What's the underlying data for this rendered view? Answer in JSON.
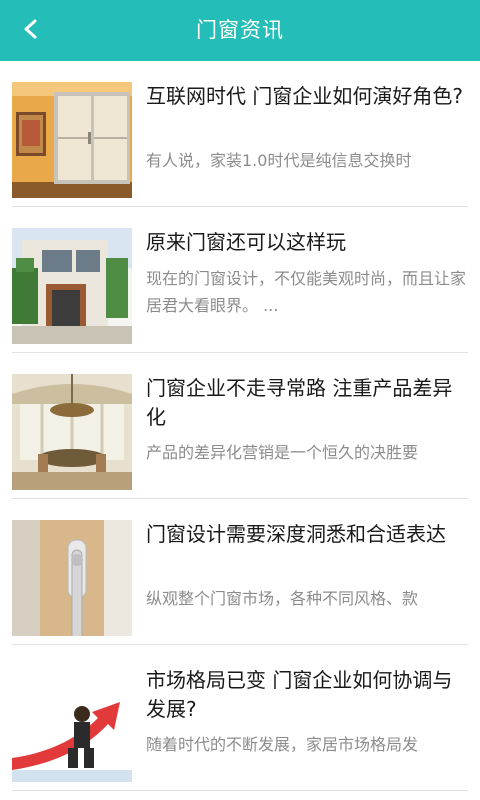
{
  "header": {
    "title": "门窗资讯",
    "back_icon": "chevron-left-icon",
    "background_color": "#24bdb7"
  },
  "articles": [
    {
      "title": "互联网时代 门窗企业如何演好角色?",
      "summary": "有人说，家装1.0时代是纯信息交换时",
      "image": "sliding-door-room-photo"
    },
    {
      "title": "原来门窗还可以这样玩",
      "summary": "现在的门窗设计，不仅能美观时尚，而且让家居君大看眼界。 ...",
      "image": "modern-house-exterior-photo"
    },
    {
      "title": "门窗企业不走寻常路 注重产品差异化",
      "summary": "产品的差异化营销是一个恒久的决胜要",
      "image": "dining-room-chandelier-photo"
    },
    {
      "title": "门窗设计需要深度洞悉和合适表达",
      "summary": "纵观整个门窗市场，各种不同风格、款",
      "image": "door-handle-closeup-photo"
    },
    {
      "title": "市场格局已变 门窗企业如何协调与发展?",
      "summary": "随着时代的不断发展，家居市场格局发",
      "image": "businessman-red-arrow-illustration"
    }
  ]
}
